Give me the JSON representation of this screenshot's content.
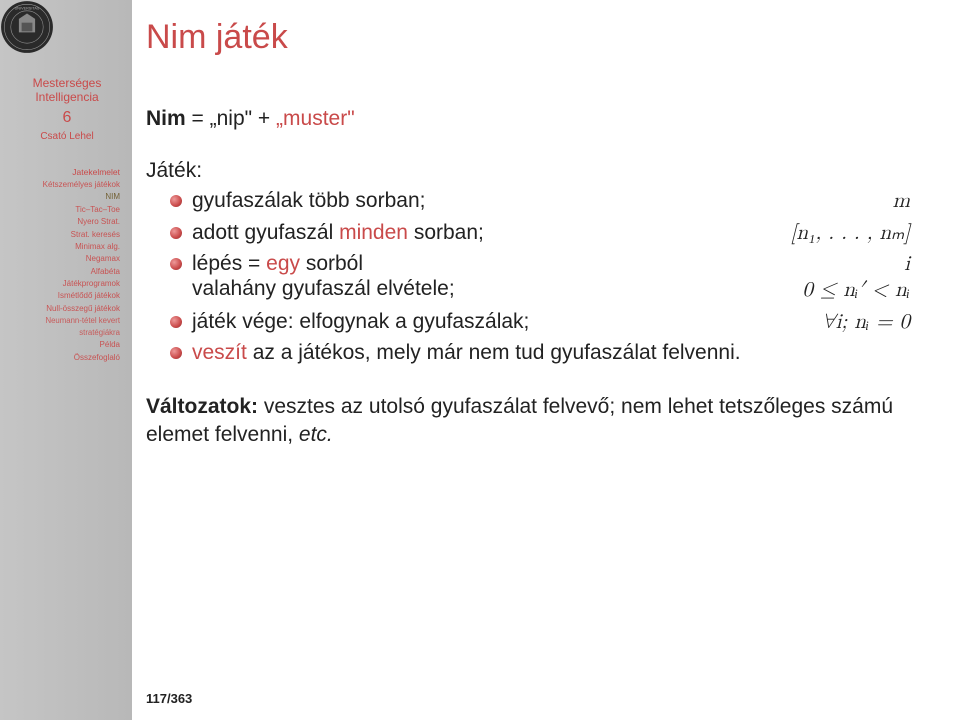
{
  "sidebar": {
    "course_title_l1": "Mesterséges",
    "course_title_l2": "Intelligencia",
    "chapter": "6",
    "author": "Csató Lehel",
    "nav": [
      {
        "label": "Jatekelmelet",
        "cls": "nav-item"
      },
      {
        "label": "Kétszemélyes játékok",
        "cls": "nav-item sub"
      },
      {
        "label": "NIM",
        "cls": "nav-item sub active"
      },
      {
        "label": "Tic–Tac–Toe",
        "cls": "nav-item sub"
      },
      {
        "label": "Nyero Strat.",
        "cls": "nav-item sub"
      },
      {
        "label": "Strat. keresés",
        "cls": "nav-item sub"
      },
      {
        "label": "Minimax alg.",
        "cls": "nav-item sub"
      },
      {
        "label": "Negamax",
        "cls": "nav-item sub"
      },
      {
        "label": "Alfabéta",
        "cls": "nav-item sub"
      },
      {
        "label": "Játékprogramok",
        "cls": "nav-item sub"
      },
      {
        "label": "Ismétlődő játékok",
        "cls": "nav-item sub"
      },
      {
        "label": "Null-összegű játékok",
        "cls": "nav-item sub"
      },
      {
        "label": "Neumann-tétel kevert",
        "cls": "nav-item sub2"
      },
      {
        "label": "stratégiákra",
        "cls": "nav-item sub2"
      },
      {
        "label": "Példa",
        "cls": "nav-item sub"
      },
      {
        "label": "Összefoglaló",
        "cls": "nav-item sub"
      }
    ]
  },
  "main": {
    "title": "Nim játék",
    "def_bold": "Nim",
    "def_mid": " = „nip\" + ",
    "def_red": "„muster\"",
    "jatek_label": "Játék:",
    "items": [
      {
        "text": "gyufaszálak több sorban;",
        "math": "m"
      },
      {
        "text_pre": "adott gyufaszál ",
        "text_red": "minden",
        "text_post": " sorban;",
        "math": "[n₁, . . . , nₘ]"
      },
      {
        "text_pre": "lépés = ",
        "text_red": "egy",
        "text_post": " sorból valahány gyufaszál elvétele;",
        "math": "i",
        "math2": "0 ≤ nᵢ′ < nᵢ",
        "two": true
      },
      {
        "text": "játék vége: elfogynak a gyufaszálak;",
        "math": "∀i;  nᵢ = 0"
      },
      {
        "text_pre": "",
        "text_red": "veszít",
        "text_post": " az a játékos, mely már nem tud gyufaszálat felvenni."
      }
    ],
    "variations_bold": "Változatok:",
    "variations_rest": " vesztes az utolsó gyufaszálat felvevő; nem lehet tetszőleges számú elemet felvenni, ",
    "variations_etc": "etc.",
    "page": "117/363"
  }
}
